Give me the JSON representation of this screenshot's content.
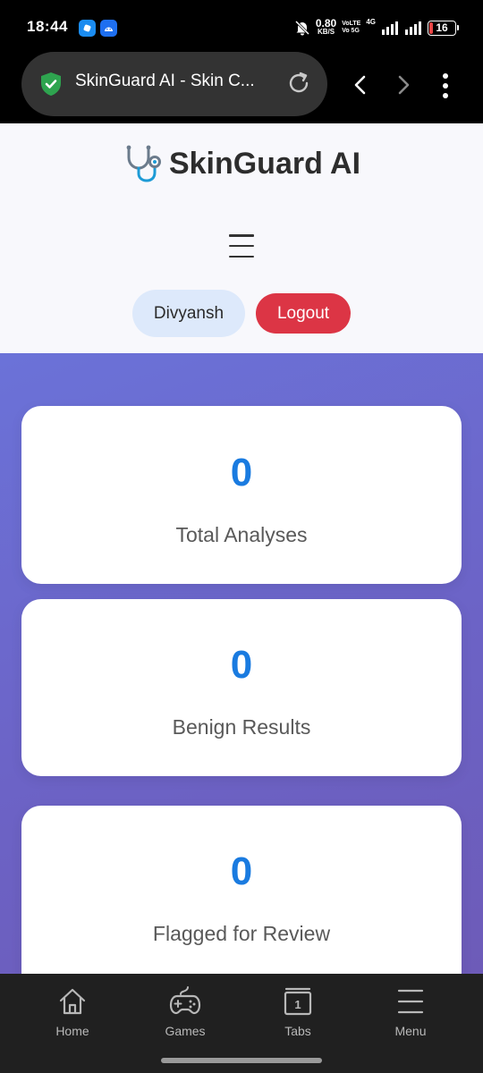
{
  "status_bar": {
    "time": "18:44",
    "net_speed_value": "0.80",
    "net_speed_unit": "KB/S",
    "volte_top": "VoLTE",
    "volte_bottom": "Vo 5G",
    "network_type": "4G",
    "battery_level": "16",
    "battery_fraction": 0.16,
    "battery_color": "#e84545"
  },
  "browser": {
    "tab_title": "SkinGuard AI - Skin C...",
    "secure_icon": "shield-check-icon",
    "secure_color": "#2ea44f"
  },
  "header": {
    "brand_icon": "stethoscope-icon",
    "brand_title": "SkinGuard AI",
    "menu_icon": "hamburger-menu-icon",
    "user_name": "Divyansh",
    "logout_label": "Logout",
    "logout_color": "#dc3545"
  },
  "stats": [
    {
      "value": "0",
      "label": "Total Analyses"
    },
    {
      "value": "0",
      "label": "Benign Results"
    },
    {
      "value": "0",
      "label": "Flagged for Review"
    }
  ],
  "bottom_nav": {
    "items": [
      {
        "label": "Home",
        "icon": "home-icon"
      },
      {
        "label": "Games",
        "icon": "gamepad-icon"
      },
      {
        "label": "Tabs",
        "icon": "tabs-icon",
        "count": "1"
      },
      {
        "label": "Menu",
        "icon": "menu-icon"
      }
    ]
  },
  "colors": {
    "accent_value": "#1a7be0",
    "gradient_start": "#6b72d8",
    "gradient_end": "#6d5bb8"
  }
}
